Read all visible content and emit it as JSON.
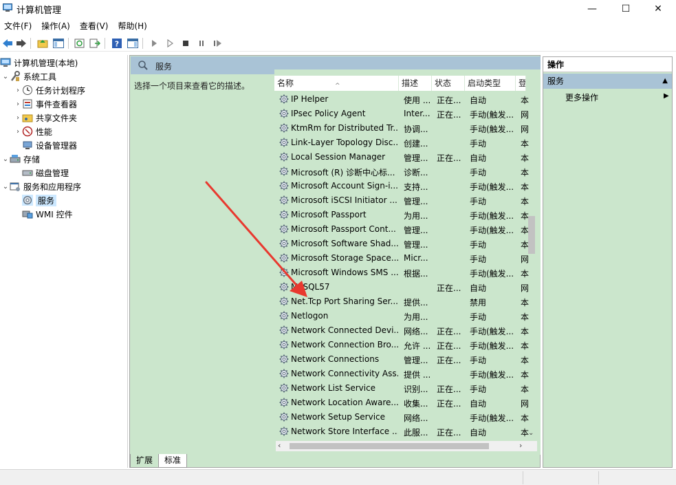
{
  "window": {
    "title": "计算机管理",
    "controls": {
      "minimize": "—",
      "maximize": "☐",
      "close": "✕"
    }
  },
  "menu": [
    "文件(F)",
    "操作(A)",
    "查看(V)",
    "帮助(H)"
  ],
  "toolbar": {
    "icons": [
      "back-icon",
      "forward-icon",
      "up-folder-icon",
      "show-hide-console-tree-icon",
      "refresh-icon",
      "export-list-icon",
      "help-icon",
      "show-hide-action-pane-icon",
      "start-service-icon",
      "start-alt-icon",
      "stop-service-icon",
      "pause-service-icon",
      "restart-service-icon"
    ]
  },
  "tree": {
    "items": [
      {
        "label": "计算机管理(本地)",
        "icon": "computer-management-icon",
        "level": 0,
        "expander": ""
      },
      {
        "label": "系统工具",
        "icon": "tools-icon",
        "level": 1,
        "expander": "⌄"
      },
      {
        "label": "任务计划程序",
        "icon": "clock-icon",
        "level": 2,
        "expander": "›"
      },
      {
        "label": "事件查看器",
        "icon": "event-viewer-icon",
        "level": 2,
        "expander": "›"
      },
      {
        "label": "共享文件夹",
        "icon": "shared-folder-icon",
        "level": 2,
        "expander": "›"
      },
      {
        "label": "性能",
        "icon": "performance-icon",
        "level": 2,
        "expander": "›"
      },
      {
        "label": "设备管理器",
        "icon": "device-manager-icon",
        "level": 2,
        "expander": ""
      },
      {
        "label": "存储",
        "icon": "storage-icon",
        "level": 1,
        "expander": "⌄"
      },
      {
        "label": "磁盘管理",
        "icon": "disk-icon",
        "level": 2,
        "expander": ""
      },
      {
        "label": "服务和应用程序",
        "icon": "services-apps-icon",
        "level": 1,
        "expander": "⌄"
      },
      {
        "label": "服务",
        "icon": "services-gear-icon",
        "level": 2,
        "expander": "",
        "selected": true
      },
      {
        "label": "WMI 控件",
        "icon": "wmi-icon",
        "level": 2,
        "expander": ""
      }
    ]
  },
  "center": {
    "header": "服务",
    "description": "选择一个项目来查看它的描述。",
    "columns": [
      "名称",
      "描述",
      "状态",
      "启动类型",
      "登"
    ],
    "rows": [
      {
        "name": "IP Helper",
        "desc": "使用 ...",
        "status": "正在...",
        "startup": "自动",
        "logon": "本"
      },
      {
        "name": "IPsec Policy Agent",
        "desc": "Inter...",
        "status": "正在...",
        "startup": "手动(触发...",
        "logon": "网"
      },
      {
        "name": "KtmRm for Distributed Tr...",
        "desc": "协调...",
        "status": "",
        "startup": "手动(触发...",
        "logon": "网"
      },
      {
        "name": "Link-Layer Topology Disc...",
        "desc": "创建...",
        "status": "",
        "startup": "手动",
        "logon": "本"
      },
      {
        "name": "Local Session Manager",
        "desc": "管理...",
        "status": "正在...",
        "startup": "自动",
        "logon": "本"
      },
      {
        "name": "Microsoft (R) 诊断中心标...",
        "desc": "诊断...",
        "status": "",
        "startup": "手动",
        "logon": "本"
      },
      {
        "name": "Microsoft Account Sign-i...",
        "desc": "支持...",
        "status": "",
        "startup": "手动(触发...",
        "logon": "本"
      },
      {
        "name": "Microsoft iSCSI Initiator ...",
        "desc": "管理...",
        "status": "",
        "startup": "手动",
        "logon": "本"
      },
      {
        "name": "Microsoft Passport",
        "desc": "为用...",
        "status": "",
        "startup": "手动(触发...",
        "logon": "本"
      },
      {
        "name": "Microsoft Passport Cont...",
        "desc": "管理...",
        "status": "",
        "startup": "手动(触发...",
        "logon": "本"
      },
      {
        "name": "Microsoft Software Shad...",
        "desc": "管理...",
        "status": "",
        "startup": "手动",
        "logon": "本"
      },
      {
        "name": "Microsoft Storage Space...",
        "desc": "Micr...",
        "status": "",
        "startup": "手动",
        "logon": "网"
      },
      {
        "name": "Microsoft Windows SMS ...",
        "desc": "根据...",
        "status": "",
        "startup": "手动(触发...",
        "logon": "本"
      },
      {
        "name": "MySQL57",
        "desc": "",
        "status": "正在...",
        "startup": "自动",
        "logon": "网"
      },
      {
        "name": "Net.Tcp Port Sharing Ser...",
        "desc": "提供...",
        "status": "",
        "startup": "禁用",
        "logon": "本"
      },
      {
        "name": "Netlogon",
        "desc": "为用...",
        "status": "",
        "startup": "手动",
        "logon": "本"
      },
      {
        "name": "Network Connected Devi...",
        "desc": "网络...",
        "status": "正在...",
        "startup": "手动(触发...",
        "logon": "本"
      },
      {
        "name": "Network Connection Bro...",
        "desc": "允许 ...",
        "status": "正在...",
        "startup": "手动(触发...",
        "logon": "本"
      },
      {
        "name": "Network Connections",
        "desc": "管理...",
        "status": "正在...",
        "startup": "手动",
        "logon": "本"
      },
      {
        "name": "Network Connectivity Ass...",
        "desc": "提供 ...",
        "status": "",
        "startup": "手动(触发...",
        "logon": "本"
      },
      {
        "name": "Network List Service",
        "desc": "识别...",
        "status": "正在...",
        "startup": "手动",
        "logon": "本"
      },
      {
        "name": "Network Location Aware...",
        "desc": "收集...",
        "status": "正在...",
        "startup": "自动",
        "logon": "网"
      },
      {
        "name": "Network Setup Service",
        "desc": "网络...",
        "status": "",
        "startup": "手动(触发...",
        "logon": "本"
      },
      {
        "name": "Network Store Interface ...",
        "desc": "此服...",
        "status": "正在...",
        "startup": "自动",
        "logon": "本"
      }
    ],
    "tabs": [
      "扩展",
      "标准"
    ],
    "active_tab": "扩展"
  },
  "actions": {
    "title": "操作",
    "section": "服务",
    "more": "更多操作"
  },
  "colors": {
    "pane_green": "#cbe6cc",
    "header_blue": "#a9c3d6",
    "selection": "#cce8ff",
    "annotation_red": "#e8392f"
  }
}
